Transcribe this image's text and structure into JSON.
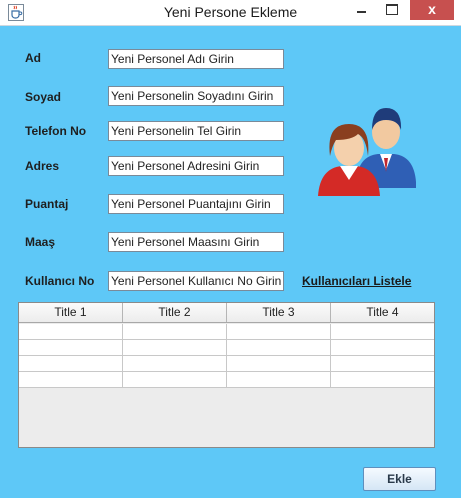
{
  "window": {
    "title": "Yeni Persone Ekleme",
    "close_symbol": "x",
    "icons": {
      "app": "java-cup-icon",
      "people": "users-icon"
    },
    "colors": {
      "background": "#5ec8f7",
      "close": "#c7504f"
    }
  },
  "form": {
    "fields": [
      {
        "label": "Ad",
        "value": "Yeni Personel Adı Girin"
      },
      {
        "label": "Soyad",
        "value": "Yeni Personelin Soyadını Girin"
      },
      {
        "label": "Telefon No",
        "value": "Yeni Personelin Tel Girin"
      },
      {
        "label": "Adres",
        "value": "Yeni Personel Adresini Girin"
      },
      {
        "label": "Puantaj",
        "value": "Yeni Personel Puantajını Girin"
      },
      {
        "label": "Maaş",
        "value": "Yeni Personel Maasını Girin"
      },
      {
        "label": "Kullanıcı No",
        "value": "Yeni Personel Kullanıcı No Girin"
      }
    ],
    "list_link": "Kullanıcıları Listele"
  },
  "table": {
    "columns": [
      "Title 1",
      "Title 2",
      "Title 3",
      "Title 4"
    ],
    "rows": [
      [
        "",
        "",
        "",
        ""
      ],
      [
        "",
        "",
        "",
        ""
      ],
      [
        "",
        "",
        "",
        ""
      ],
      [
        "",
        "",
        "",
        ""
      ]
    ]
  },
  "actions": {
    "add_label": "Ekle"
  }
}
